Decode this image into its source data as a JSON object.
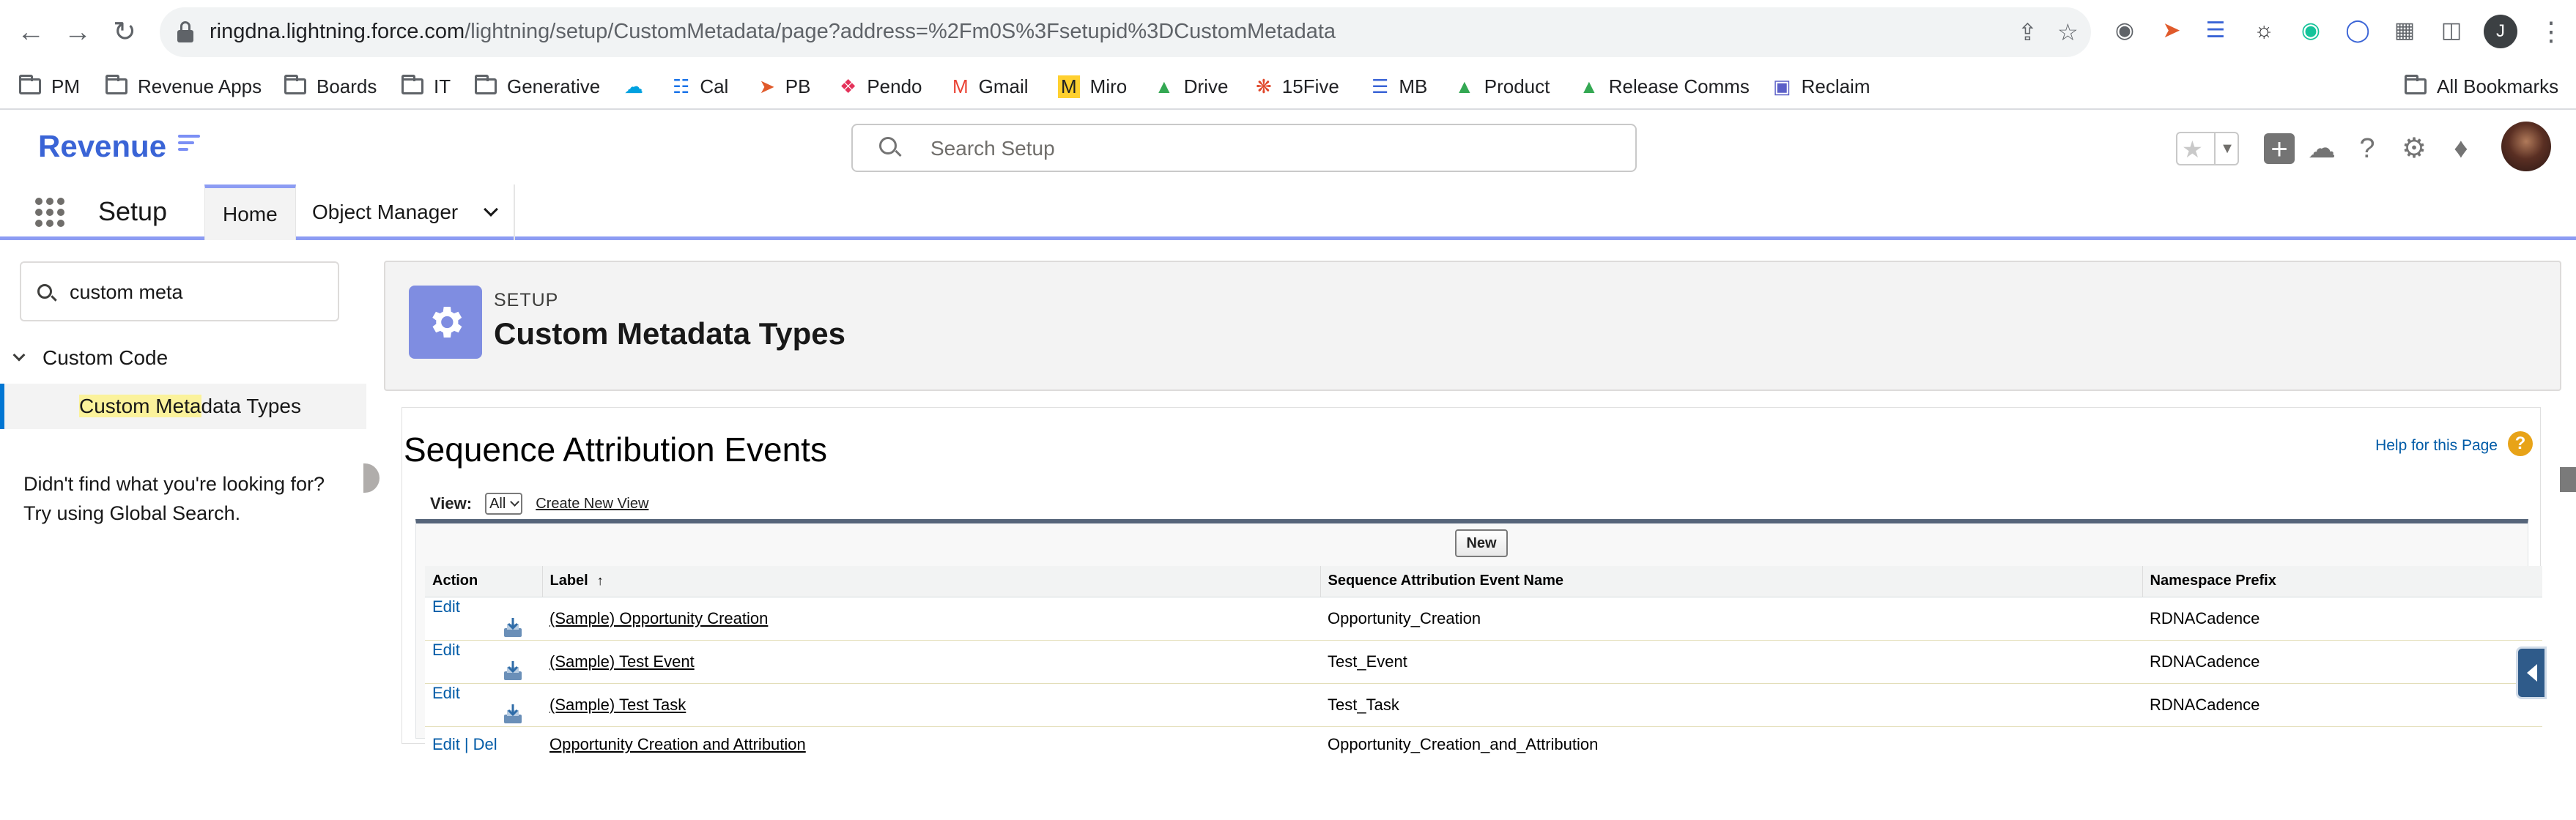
{
  "browser": {
    "url_host": "ringdna.lightning.force.com",
    "url_path": "/lightning/setup/CustomMetadata/page?address=%2Fm0S%3Fsetupid%3DCustomMetadata",
    "profile_initial": "J"
  },
  "bookmarks": {
    "items": [
      {
        "label": "PM"
      },
      {
        "label": "Revenue Apps"
      },
      {
        "label": "Boards"
      },
      {
        "label": "IT"
      },
      {
        "label": "Generative"
      },
      {
        "label": ""
      },
      {
        "label": "Cal"
      },
      {
        "label": "PB"
      },
      {
        "label": "Pendo"
      },
      {
        "label": "Gmail"
      },
      {
        "label": "Miro"
      },
      {
        "label": "Drive"
      },
      {
        "label": "15Five"
      },
      {
        "label": "MB"
      },
      {
        "label": "Product"
      },
      {
        "label": "Release Comms"
      },
      {
        "label": "Reclaim"
      }
    ],
    "all_bookmarks": "All Bookmarks"
  },
  "header": {
    "logo": "Revenue",
    "search_placeholder": "Search Setup",
    "accent_color": "#3a64d6"
  },
  "nav": {
    "app_name": "Setup",
    "tabs": [
      {
        "label": "Home"
      },
      {
        "label": "Object Manager"
      }
    ]
  },
  "sidebar": {
    "quickfind_value": "custom meta",
    "section": "Custom Code",
    "item_highlight": "Custom Meta",
    "item_rest": "data Types",
    "help_line1": "Didn't find what you're looking for?",
    "help_line2": "Try using Global Search."
  },
  "page_header": {
    "crumb": "SETUP",
    "title": "Custom Metadata Types"
  },
  "list": {
    "title": "Sequence Attribution Events",
    "help_link": "Help for this Page",
    "help_badge": "?",
    "view_label": "View:",
    "view_value": "All",
    "create_view": "Create New View",
    "new_button": "New",
    "columns": [
      "Action",
      "Label",
      "Sequence Attribution Event Name",
      "Namespace Prefix"
    ],
    "rows": [
      {
        "actions": [
          "Edit"
        ],
        "installed": true,
        "label": "(Sample) Opportunity Creation",
        "name": "Opportunity_Creation",
        "namespace": "RDNACadence"
      },
      {
        "actions": [
          "Edit"
        ],
        "installed": true,
        "label": "(Sample) Test Event",
        "name": "Test_Event",
        "namespace": "RDNACadence"
      },
      {
        "actions": [
          "Edit"
        ],
        "installed": true,
        "label": "(Sample) Test Task",
        "name": "Test_Task",
        "namespace": "RDNACadence"
      },
      {
        "actions": [
          "Edit",
          "Del"
        ],
        "installed": false,
        "label": "Opportunity Creation and Attribution",
        "name": "Opportunity_Creation_and_Attribution",
        "namespace": ""
      }
    ],
    "action_separator": "|",
    "sort_indicator": "↑"
  }
}
